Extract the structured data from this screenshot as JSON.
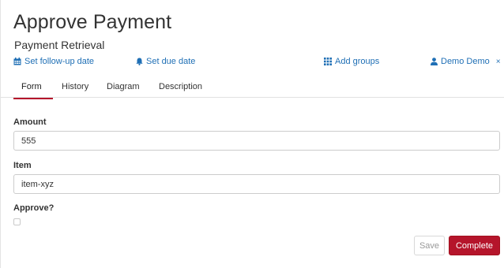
{
  "page": {
    "title": "Approve Payment",
    "subtitle": "Payment Retrieval"
  },
  "actions": {
    "follow_up": "Set follow-up date",
    "due_date": "Set due date",
    "add_groups": "Add groups",
    "assignee": "Demo Demo",
    "remove": "×"
  },
  "tabs": [
    "Form",
    "History",
    "Diagram",
    "Description"
  ],
  "active_tab": "Form",
  "form": {
    "amount": {
      "label": "Amount",
      "value": "555"
    },
    "item": {
      "label": "Item",
      "value": "item-xyz"
    },
    "approve": {
      "label": "Approve?",
      "checked": false
    }
  },
  "buttons": {
    "save": "Save",
    "complete": "Complete"
  },
  "icons": {
    "follow_up": "calendar-icon",
    "due_date": "bell-icon",
    "add_groups": "grid-icon",
    "assignee": "user-icon"
  },
  "colors": {
    "accent": "#b5152b",
    "link": "#1f6fb5"
  }
}
